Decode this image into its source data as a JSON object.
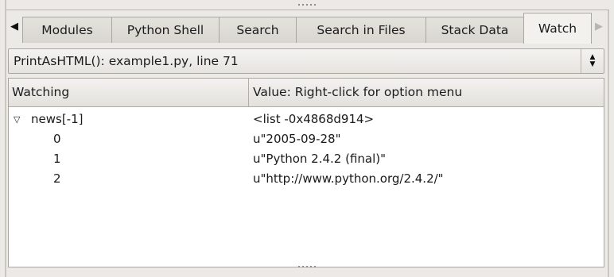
{
  "tabs": [
    {
      "label": "Modules",
      "active": false
    },
    {
      "label": "Python Shell",
      "active": false
    },
    {
      "label": "Search",
      "active": false
    },
    {
      "label": "Search in Files",
      "active": false
    },
    {
      "label": "Stack Data",
      "active": false
    },
    {
      "label": "Watch",
      "active": true
    }
  ],
  "location": {
    "text": "PrintAsHTML(): example1.py, line 71"
  },
  "list": {
    "columns": {
      "name": "Watching",
      "value": "Value:  Right-click for option menu"
    },
    "rows": [
      {
        "name": "news[-1]",
        "value": "<list -0x4868d914>",
        "expandable": true,
        "expanded": true
      },
      {
        "name": "0",
        "value": "u\"2005-09-28\"",
        "expandable": false
      },
      {
        "name": "1",
        "value": "u\"Python 2.4.2 (final)\"",
        "expandable": false
      },
      {
        "name": "2",
        "value": "u\"http://www.python.org/2.4.2/\"",
        "expandable": false
      }
    ]
  },
  "icons": {
    "tab_scroll_left": "triangle-left-icon",
    "tab_scroll_right": "triangle-right-icon",
    "combo_spin": "spin-up-down-icon",
    "expander": "expanded-triangle-icon"
  }
}
